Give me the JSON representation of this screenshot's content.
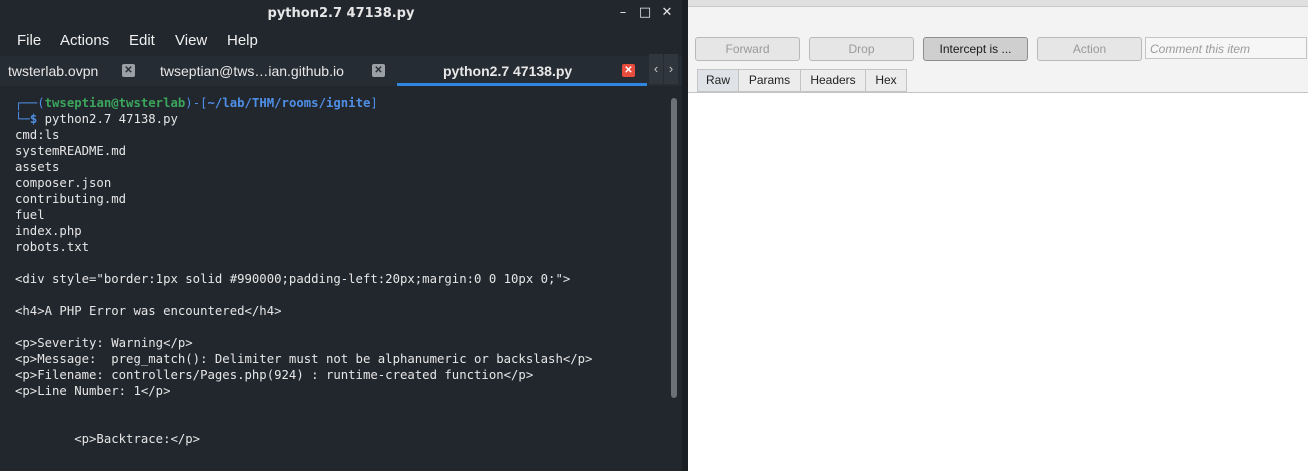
{
  "terminal": {
    "title": "python2.7 47138.py",
    "window_buttons": {
      "minimize": "–",
      "maximize": "□",
      "close": "✕"
    },
    "menu": [
      "File",
      "Actions",
      "Edit",
      "View",
      "Help"
    ],
    "tabs": [
      {
        "label": "twsterlab.ovpn"
      },
      {
        "label": "twseptian@tws…ian.github.io"
      },
      {
        "label": "python2.7 47138.py",
        "active": true
      }
    ],
    "tab_close_glyph": "✕",
    "tab_arrows": {
      "left": "‹",
      "right": "›"
    },
    "prompt": {
      "frame_top": "┌──(",
      "user_host": "twseptian@twsterlab",
      "frame_mid": ")-[",
      "path": "~/lab/THM/rooms/ignite",
      "frame_end": "]",
      "frame_bottom": "└─",
      "symbol": "$",
      "command": "python2.7 47138.py"
    },
    "output_lines": [
      "cmd:ls",
      "systemREADME.md",
      "assets",
      "composer.json",
      "contributing.md",
      "fuel",
      "index.php",
      "robots.txt",
      "",
      "<div style=\"border:1px solid #990000;padding-left:20px;margin:0 0 10px 0;\">",
      "",
      "<h4>A PHP Error was encountered</h4>",
      "",
      "<p>Severity: Warning</p>",
      "<p>Message:  preg_match(): Delimiter must not be alphanumeric or backslash</p>",
      "<p>Filename: controllers/Pages.php(924) : runtime-created function</p>",
      "<p>Line Number: 1</p>",
      "",
      "",
      "        <p>Backtrace:</p>"
    ]
  },
  "burp": {
    "buttons": {
      "forward": "Forward",
      "drop": "Drop",
      "intercept": "Intercept is ...",
      "action": "Action"
    },
    "comment_placeholder": "Comment this item",
    "subtabs": [
      "Raw",
      "Params",
      "Headers",
      "Hex"
    ]
  },
  "colors": {
    "terminal_bg": "#22272e",
    "prompt_user": "#3ba55c",
    "prompt_path": "#4f8fe6",
    "active_tab_underline": "#2e86de",
    "active_tab_close": "#e74c3c"
  }
}
